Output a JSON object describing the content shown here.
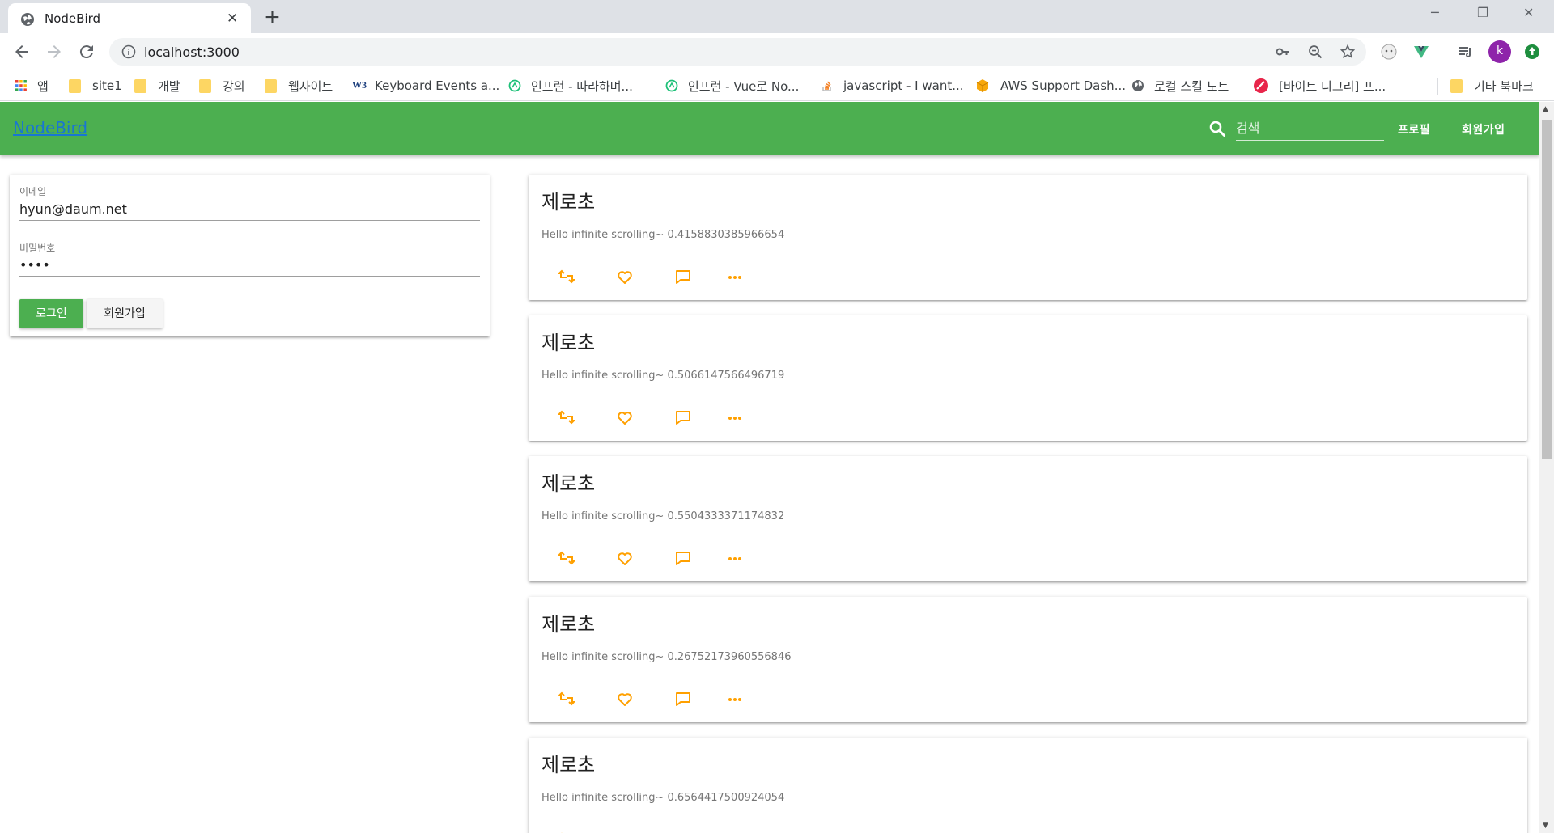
{
  "browser": {
    "tab_title": "NodeBird",
    "tab_close": "✕",
    "new_tab": "+",
    "url": "localhost:3000",
    "avatar_letter": "k",
    "window_controls": [
      "─",
      "❐",
      "✕"
    ]
  },
  "bookmarks": [
    {
      "label": "앱",
      "icon": "apps-grid-icon"
    },
    {
      "label": "site1",
      "icon": "folder-icon"
    },
    {
      "label": "개발",
      "icon": "folder-icon"
    },
    {
      "label": "강의",
      "icon": "folder-icon"
    },
    {
      "label": "웹사이트",
      "icon": "folder-icon"
    },
    {
      "label": "Keyboard Events a...",
      "icon": "w3-icon"
    },
    {
      "label": "인프런 - 따라하며...",
      "icon": "inflearn-icon"
    },
    {
      "label": "인프런 - Vue로 No...",
      "icon": "inflearn-icon"
    },
    {
      "label": "javascript - I want...",
      "icon": "stackoverflow-icon"
    },
    {
      "label": "AWS Support Dash...",
      "icon": "aws-icon"
    },
    {
      "label": "로컬 스킬 노트",
      "icon": "globe-icon"
    },
    {
      "label": "[바이트 디그리] 프...",
      "icon": "byte-degree-icon"
    },
    {
      "label": "기타 북마크",
      "icon": "folder-icon"
    }
  ],
  "appbar": {
    "brand": "NodeBird",
    "search_placeholder": "검색",
    "nav_profile": "프로필",
    "nav_signup": "회원가입"
  },
  "login": {
    "email_label": "이메일",
    "email_value": "hyun@daum.net",
    "password_label": "비밀번호",
    "password_value": "••••",
    "login_button": "로그인",
    "signup_button": "회원가입"
  },
  "posts": [
    {
      "title": "제로초",
      "content": "Hello infinite scrolling~ 0.4158830385966654"
    },
    {
      "title": "제로초",
      "content": "Hello infinite scrolling~ 0.5066147566496719"
    },
    {
      "title": "제로초",
      "content": "Hello infinite scrolling~ 0.5504333371174832"
    },
    {
      "title": "제로초",
      "content": "Hello infinite scrolling~ 0.26752173960556846"
    },
    {
      "title": "제로초",
      "content": "Hello infinite scrolling~ 0.6564417500924054"
    }
  ],
  "colors": {
    "primary": "#4caf50",
    "action": "#ffa000",
    "brand_link": "#1976d2"
  }
}
